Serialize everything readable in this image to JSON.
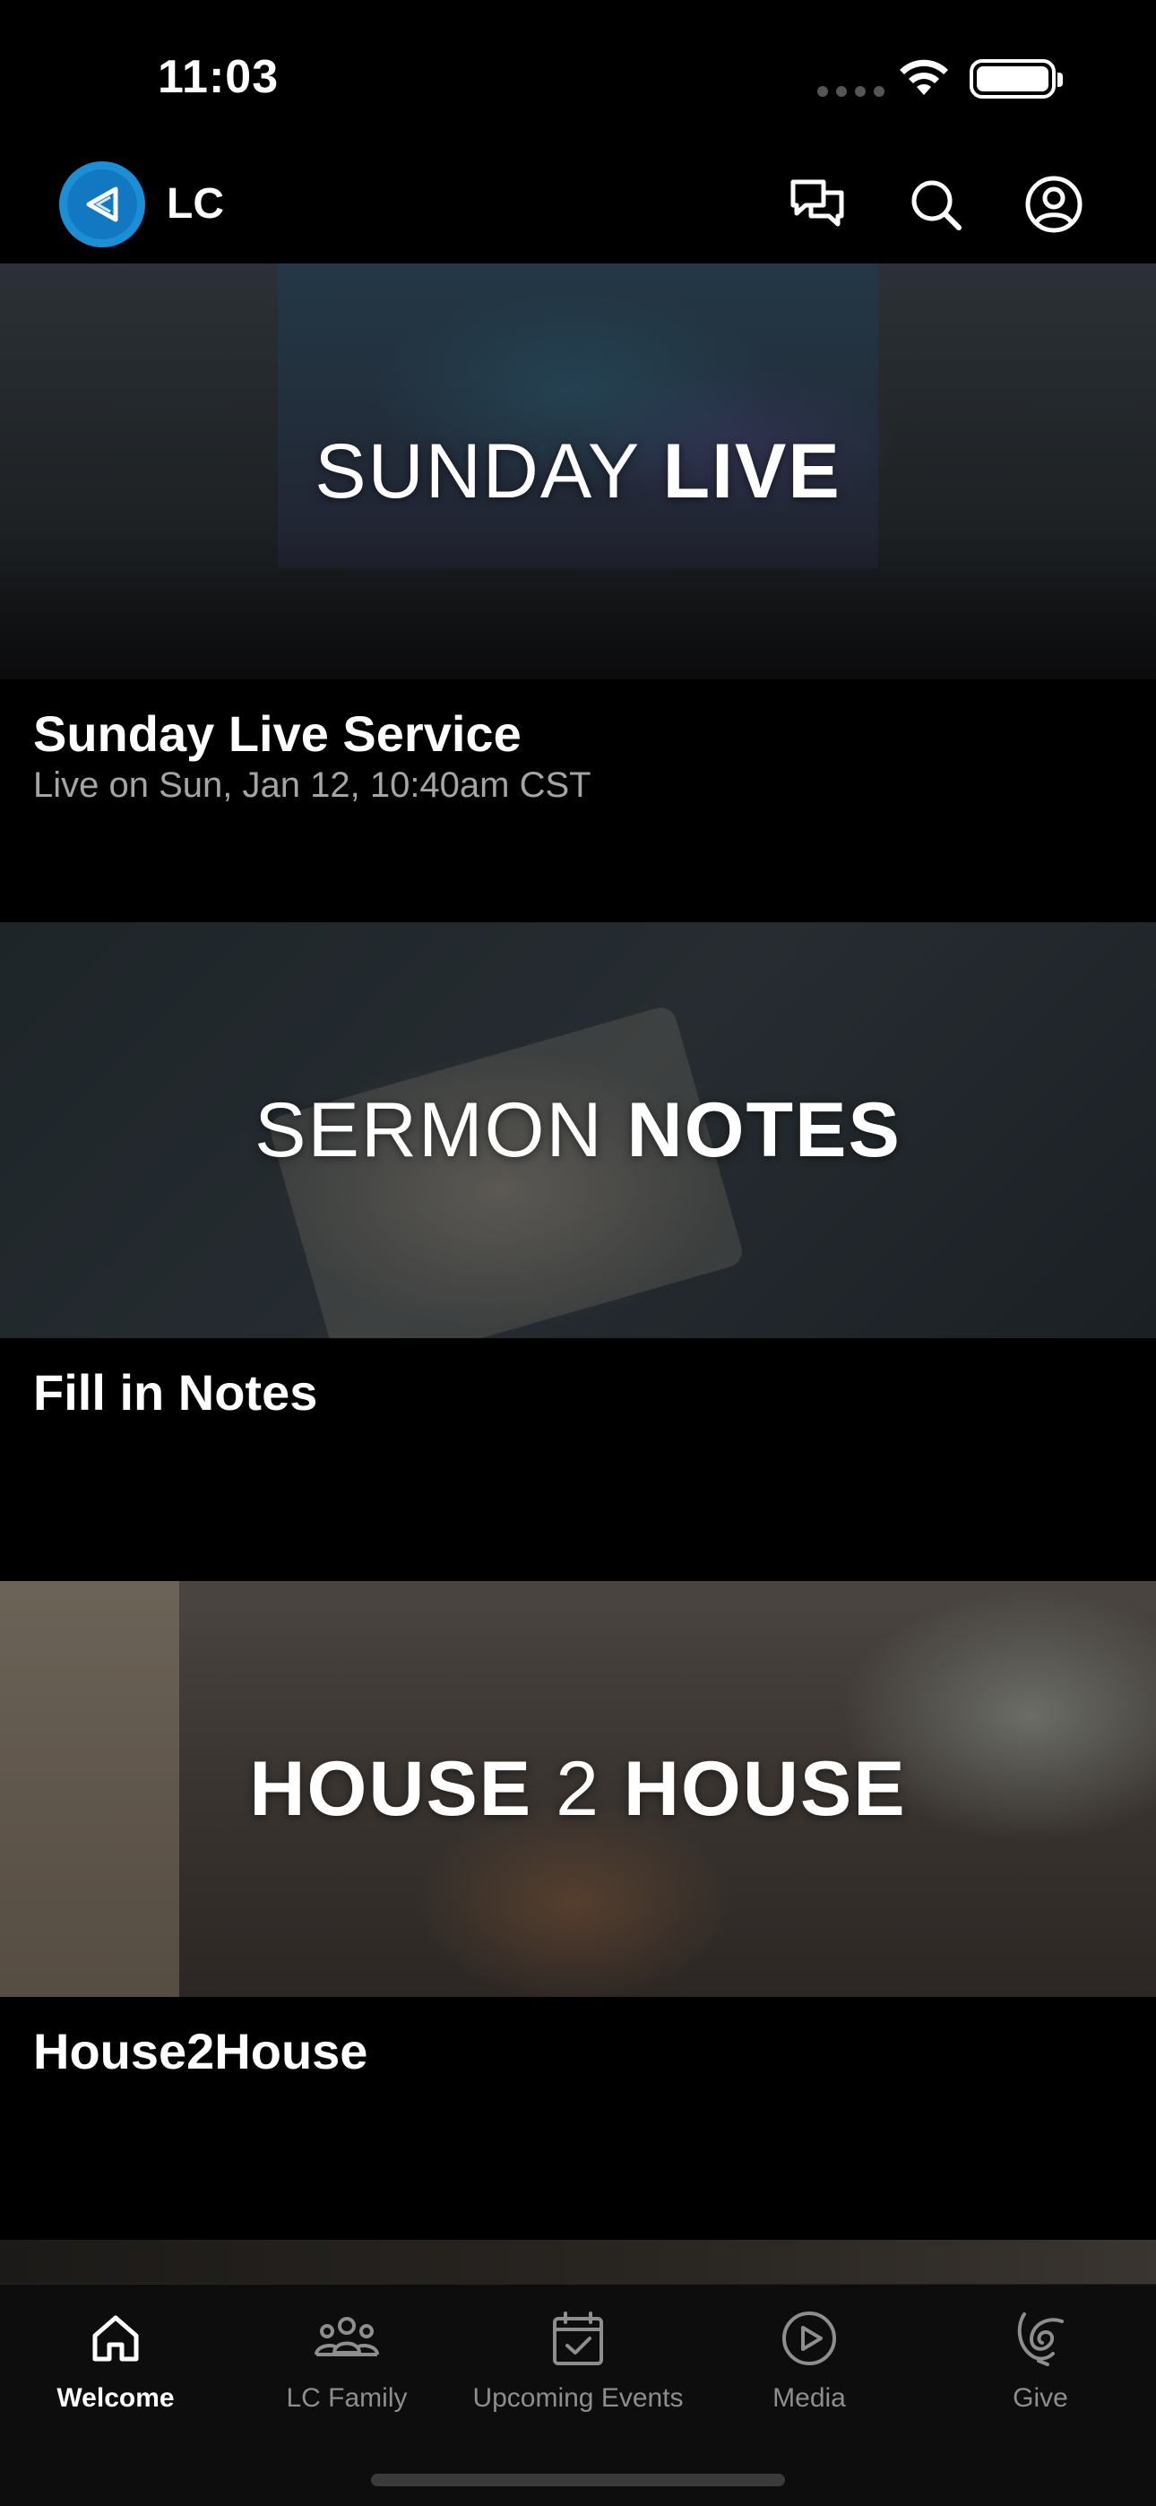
{
  "status_bar": {
    "time": "11:03"
  },
  "header": {
    "app_name": "LC"
  },
  "feed": [
    {
      "banner_light": "SUNDAY ",
      "banner_bold": "LIVE",
      "title": "Sunday Live Service",
      "subtitle": "Live on Sun, Jan 12, 10:40am CST"
    },
    {
      "banner_light": "SERMON ",
      "banner_bold": "NOTES",
      "title": "Fill in Notes",
      "subtitle": ""
    },
    {
      "banner_bold_1": "HOUSE ",
      "banner_light": "2 ",
      "banner_bold_2": "HOUSE",
      "title": "House2House",
      "subtitle": ""
    }
  ],
  "tabs": [
    {
      "label": "Welcome",
      "icon": "home-icon",
      "active": true
    },
    {
      "label": "LC Family",
      "icon": "people-icon",
      "active": false
    },
    {
      "label": "Upcoming Events",
      "icon": "calendar-check-icon",
      "active": false
    },
    {
      "label": "Media",
      "icon": "play-circle-icon",
      "active": false
    },
    {
      "label": "Give",
      "icon": "give-icon",
      "active": false
    }
  ]
}
